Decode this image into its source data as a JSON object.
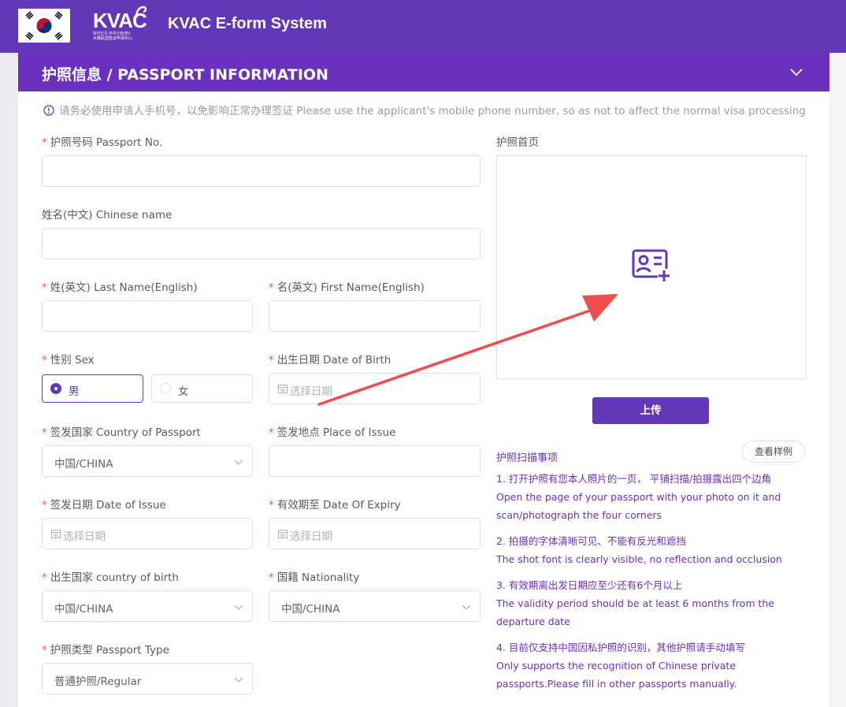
{
  "header": {
    "app_title": "KVAC E-form System",
    "logo_text": "KVAC",
    "logo_sub_ko": "대한민국 비자신청센터",
    "logo_sub_zh": "大韩民国签证申请中心"
  },
  "section": {
    "title": "护照信息 / PASSPORT INFORMATION",
    "notice": "请务必使用申请人手机号，以免影响正常办理签证 Please use the applicant's mobile phone number, so as not to affect the normal visa processing"
  },
  "form": {
    "passport_no": {
      "label": "护照号码 Passport No.",
      "value": ""
    },
    "chinese_name": {
      "label": "姓名(中文) Chinese name",
      "value": ""
    },
    "last_name": {
      "label": "姓(英文) Last Name(English)",
      "value": ""
    },
    "first_name": {
      "label": "名(英文) First Name(English)",
      "value": ""
    },
    "sex": {
      "label": "性别 Sex",
      "options": [
        "男",
        "女"
      ],
      "selected": "男"
    },
    "dob": {
      "label": "出生日期 Date of Birth",
      "placeholder": "选择日期"
    },
    "country_of_passport": {
      "label": "签发国家 Country of Passport",
      "value": "中国/CHINA"
    },
    "place_of_issue": {
      "label": "签发地点 Place of Issue",
      "value": ""
    },
    "date_of_issue": {
      "label": "签发日期 Date of Issue",
      "placeholder": "选择日期"
    },
    "date_of_expiry": {
      "label": "有效期至 Date Of Expiry",
      "placeholder": "选择日期"
    },
    "country_of_birth": {
      "label": "出生国家 country of birth",
      "value": "中国/CHINA"
    },
    "nationality": {
      "label": "国籍 Nationality",
      "value": "中国/CHINA"
    },
    "passport_type": {
      "label": "护照类型 Passport Type",
      "value": "普通护照/Regular"
    }
  },
  "upload": {
    "label": "护照首页",
    "button": "上传",
    "sample_button": "查看样例",
    "scan_title": "护照扫描事项",
    "tips": [
      {
        "zh": "1. 打开护照有您本人照片的一页， 平铺扫描/拍摄露出四个边角",
        "en": "Open the page of your passport with your photo on it and scan/photograph the four corners"
      },
      {
        "zh": "2. 拍摄的字体清晰可见、不能有反光和遮挡",
        "en": "The shot font is clearly visible, no reflection and occlusion"
      },
      {
        "zh": "3. 有效期离出发日期应至少还有6个月以上",
        "en": "The validity period should be at least 6 months from the departure date"
      },
      {
        "zh": "4. 目前仅支持中国因私护照的识别，其他护照请手动填写",
        "en": "Only supports the recognition of Chinese private passports.Please fill in other passports manually."
      }
    ]
  },
  "colors": {
    "brand": "#6237b8",
    "required": "#f25656",
    "annotation_arrow": "#ee4e4e"
  }
}
